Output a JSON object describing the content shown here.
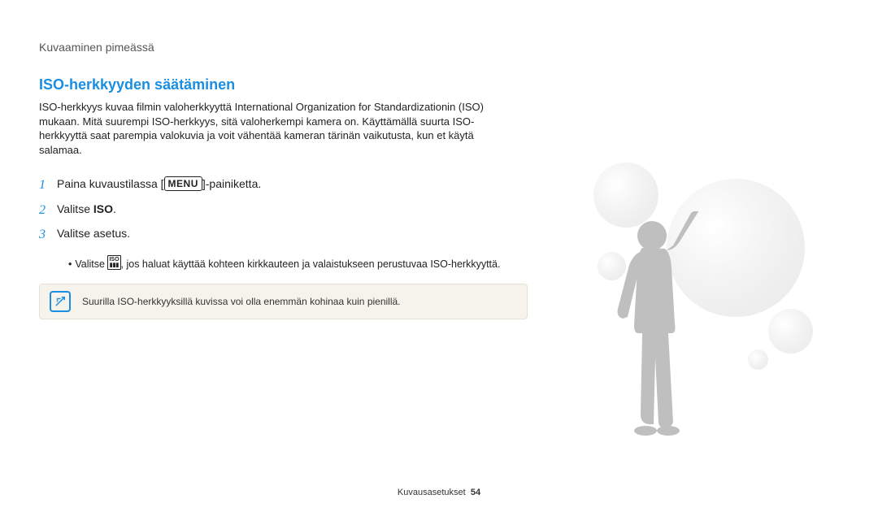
{
  "breadcrumb": "Kuvaaminen pimeässä",
  "section_title": "ISO-herkkyyden säätäminen",
  "intro": "ISO-herkkyys kuvaa filmin valoherkkyyttä International Organization for Standardizationin (ISO) mukaan. Mitä suurempi ISO-herkkyys, sitä valoherkempi kamera on. Käyttämällä suurta ISO-herkkyyttä saat parempia valokuvia ja voit vähentää kameran tärinän vaikutusta, kun et käytä salamaa.",
  "steps": {
    "s1_pre": "Paina kuvaustilassa [",
    "s1_btn": "MENU",
    "s1_post": "]-painiketta.",
    "s2_pre": "Valitse ",
    "s2_bold": "ISO",
    "s2_post": ".",
    "s3": "Valitse asetus."
  },
  "subbullet": {
    "pre": "Valitse ",
    "icon_text": "ISO AUTO",
    "post": ", jos haluat käyttää kohteen kirkkauteen ja valaistukseen perustuvaa ISO-herkkyyttä."
  },
  "note": "Suurilla ISO-herkkyyksillä kuvissa voi olla enemmän kohinaa kuin pienillä.",
  "footer_label": "Kuvausasetukset",
  "footer_page": "54"
}
